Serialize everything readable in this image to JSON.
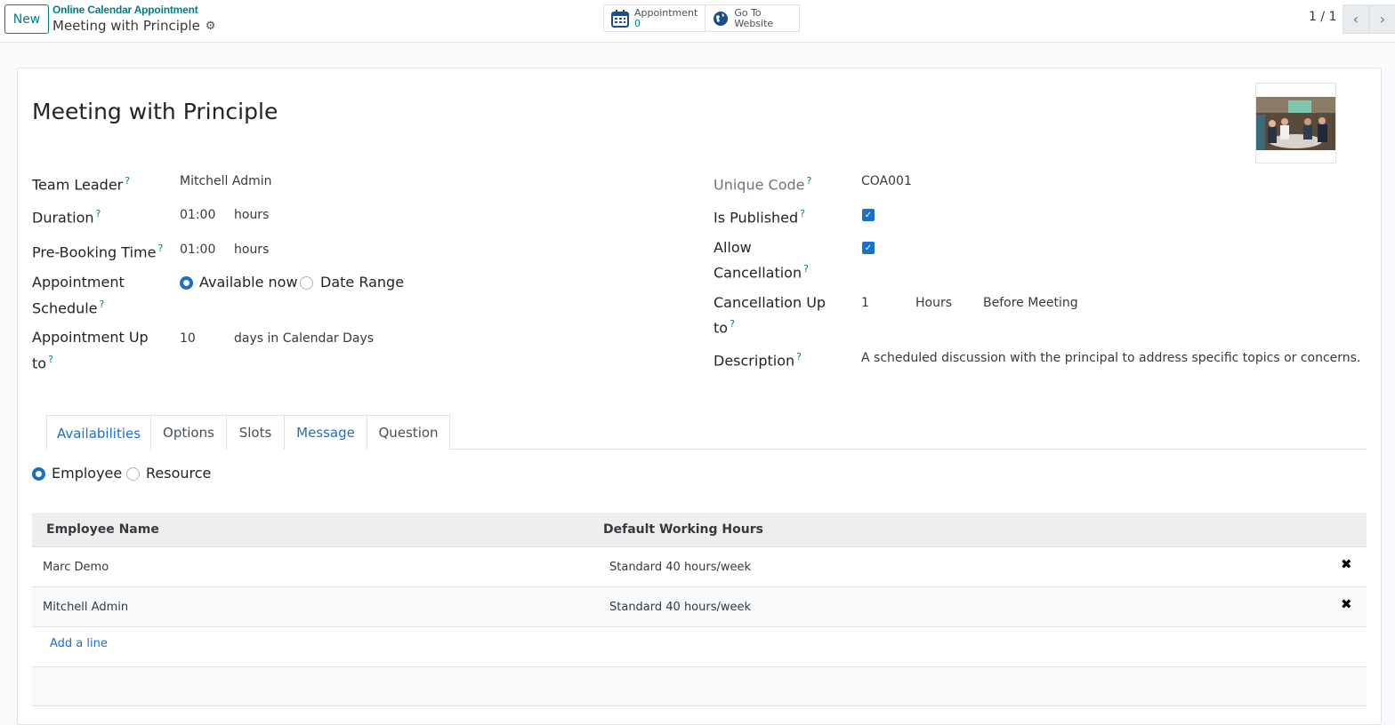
{
  "control_panel": {
    "new_label": "New",
    "breadcrumb": "Online Calendar Appointment",
    "record_name": "Meeting with Principle",
    "smart_buttons": [
      {
        "label": "Appointment",
        "value": "0",
        "icon": "calendar-icon"
      },
      {
        "label_line1": "Go To",
        "label_line2": "Website",
        "icon": "globe-icon"
      }
    ],
    "pager": "1 / 1"
  },
  "form": {
    "title": "Meeting with Principle",
    "left_fields": {
      "team_leader": {
        "label": "Team Leader",
        "value": "Mitchell Admin"
      },
      "duration": {
        "label": "Duration",
        "value": "01:00",
        "unit": "hours"
      },
      "pre_booking": {
        "label": "Pre-Booking Time",
        "value": "01:00",
        "unit": "hours"
      },
      "schedule": {
        "label_line1": "Appointment",
        "label_line2": "Schedule",
        "options": [
          "Available now",
          "Date Range"
        ],
        "selected": "Available now"
      },
      "up_to": {
        "label_line1": "Appointment Up",
        "label_line2": "to",
        "value": "10",
        "unit": "days in Calendar Days"
      }
    },
    "right_fields": {
      "unique_code": {
        "label": "Unique Code",
        "value": "COA001"
      },
      "is_published": {
        "label": "Is Published",
        "checked": true
      },
      "allow_cancellation": {
        "label_line1": "Allow",
        "label_line2": "Cancellation",
        "checked": true
      },
      "cancellation_up_to": {
        "label_line1": "Cancellation Up",
        "label_line2": "to",
        "value": "1",
        "unit": "Hours",
        "suffix": "Before Meeting"
      },
      "description": {
        "label": "Description",
        "value": "A scheduled discussion with the principal to address specific topics or concerns."
      }
    },
    "help_mark": "?"
  },
  "tabs": [
    "Availabilities",
    "Options",
    "Slots",
    "Message",
    "Question"
  ],
  "availability": {
    "options": [
      "Employee",
      "Resource"
    ],
    "selected": "Employee",
    "columns": [
      "Employee Name",
      "Default Working Hours"
    ],
    "rows": [
      {
        "name": "Marc Demo",
        "hours": "Standard 40 hours/week"
      },
      {
        "name": "Mitchell Admin",
        "hours": "Standard 40 hours/week"
      }
    ],
    "add_line": "Add a line"
  }
}
